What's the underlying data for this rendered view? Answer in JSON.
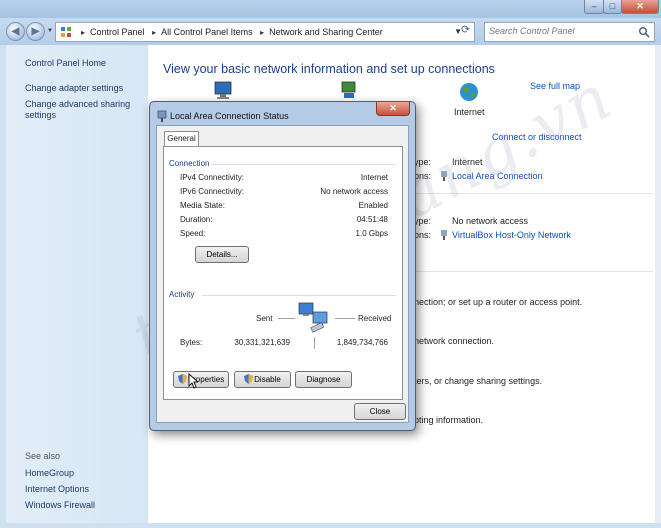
{
  "window": {
    "min_glyph": "–",
    "max_glyph": "□",
    "close_glyph": "✕"
  },
  "address": {
    "breadcrumbs": [
      "Control Panel",
      "All Control Panel Items",
      "Network and Sharing Center"
    ],
    "search_placeholder": "Search Control Panel"
  },
  "sidebar": {
    "home": "Control Panel Home",
    "links": [
      "Change adapter settings",
      "Change advanced sharing settings"
    ],
    "see_also_title": "See also",
    "see_also": [
      "HomeGroup",
      "Internet Options",
      "Windows Firewall"
    ]
  },
  "main": {
    "heading": "View your basic network information and set up connections",
    "see_full_map": "See full map",
    "internet_label": "Internet",
    "connect_disconnect": "Connect or disconnect",
    "networks": [
      {
        "access_label": "ype:",
        "access_value": "Internet",
        "conn_label": "ons:",
        "conn_link": "Local Area Connection"
      },
      {
        "access_label": "ype:",
        "access_value": "No network access",
        "conn_label": "ons:",
        "conn_link": "VirtualBox Host-Only Network"
      }
    ],
    "tasks": [
      "nection; or set up a router or access point.",
      "network connection.",
      "ters, or change sharing settings.",
      "pting information."
    ]
  },
  "dialog": {
    "title": "Local Area Connection Status",
    "tab": "General",
    "connection_title": "Connection",
    "fields": [
      {
        "label": "IPv4 Connectivity:",
        "value": "Internet"
      },
      {
        "label": "IPv6 Connectivity:",
        "value": "No network access"
      },
      {
        "label": "Media State:",
        "value": "Enabled"
      },
      {
        "label": "Duration:",
        "value": "04:51:48"
      },
      {
        "label": "Speed:",
        "value": "1.0 Gbps"
      }
    ],
    "details_button": "Details...",
    "activity_title": "Activity",
    "sent_label": "Sent",
    "received_label": "Received",
    "bytes_label": "Bytes:",
    "bytes_sent": "30,331,321,639",
    "bytes_received": "1,849,734,766",
    "properties_button": "Properties",
    "disable_button": "Disable",
    "diagnose_button": "Diagnose",
    "close_button": "Close"
  },
  "watermark": "thegioimang.vn",
  "colors": {
    "link": "#0f4fb8",
    "heading": "#1e3f8a",
    "group_title": "#1e3f8a"
  }
}
